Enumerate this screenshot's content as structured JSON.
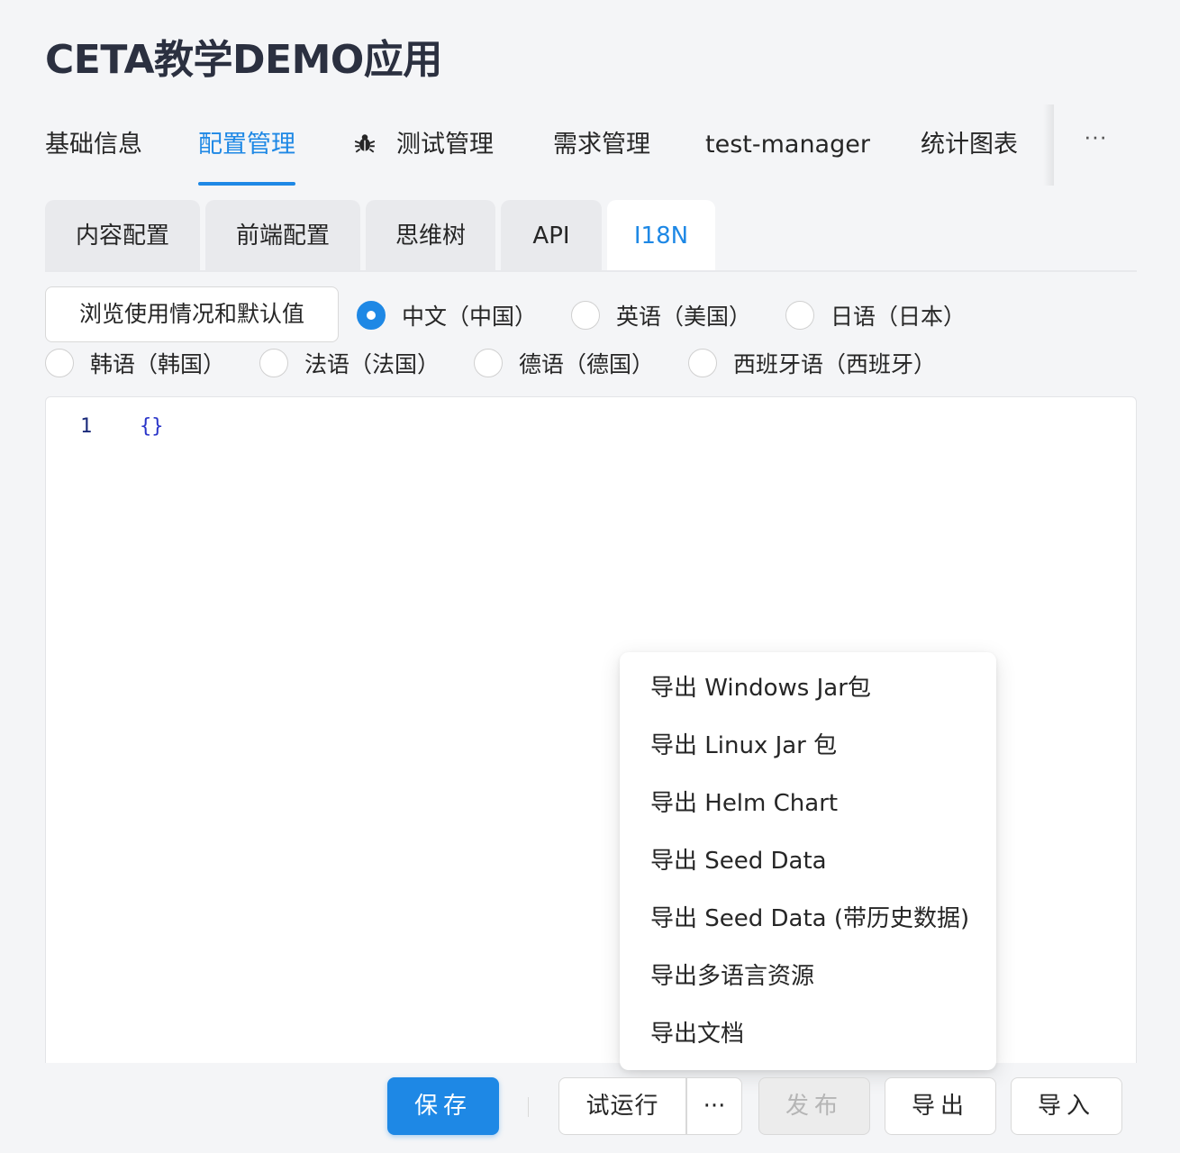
{
  "app": {
    "title": "CETA教学DEMO应用"
  },
  "main_tabs": [
    {
      "label": "基础信息"
    },
    {
      "label": "配置管理",
      "active": true
    },
    {
      "label": "测试管理",
      "icon": "bug-icon"
    },
    {
      "label": "需求管理"
    },
    {
      "label": "test-manager"
    },
    {
      "label": "统计图表"
    }
  ],
  "main_tabs_more": "···",
  "sub_tabs": [
    {
      "label": "内容配置"
    },
    {
      "label": "前端配置"
    },
    {
      "label": "思维树"
    },
    {
      "label": "API"
    },
    {
      "label": "I18N",
      "active": true
    }
  ],
  "browse_button": "浏览使用情况和默认值",
  "languages": [
    {
      "label": "中文（中国）",
      "checked": true
    },
    {
      "label": "英语（美国）"
    },
    {
      "label": "日语（日本）"
    },
    {
      "label": "韩语（韩国）"
    },
    {
      "label": "法语（法国）"
    },
    {
      "label": "德语（德国）"
    },
    {
      "label": "西班牙语（西班牙）"
    }
  ],
  "editor": {
    "line_number": "1",
    "content": "{}"
  },
  "export_menu": [
    {
      "label": "导出 Windows Jar包"
    },
    {
      "label": "导出 Linux Jar 包"
    },
    {
      "label": "导出 Helm Chart"
    },
    {
      "label": "导出 Seed Data"
    },
    {
      "label": "导出 Seed Data (带历史数据)"
    },
    {
      "label": "导出多语言资源"
    },
    {
      "label": "导出文档"
    }
  ],
  "actions": {
    "save": "保存",
    "trial_run": "试运行",
    "more": "···",
    "publish": "发布",
    "export": "导出",
    "import": "导入"
  },
  "colors": {
    "accent": "#1e88e5",
    "background": "#f4f5f7"
  }
}
